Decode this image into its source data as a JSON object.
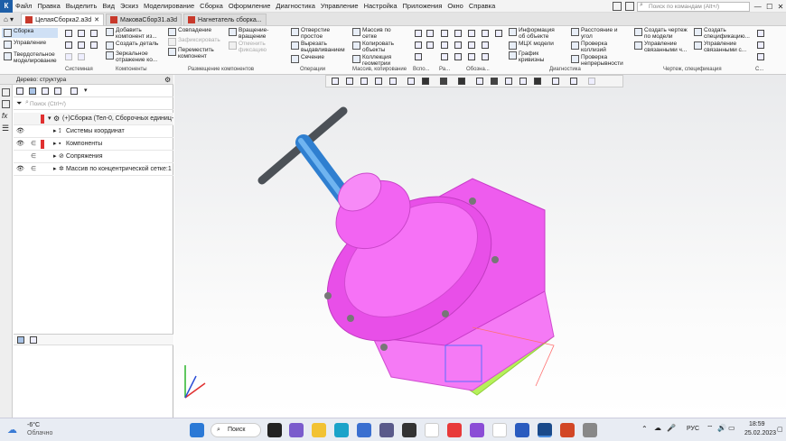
{
  "app": {
    "logo": "К"
  },
  "menu": [
    "Файл",
    "Правка",
    "Выделить",
    "Вид",
    "Эскиз",
    "Моделирование",
    "Сборка",
    "Оформление",
    "Диагностика",
    "Управление",
    "Настройка",
    "Приложения",
    "Окно",
    "Справка"
  ],
  "search": {
    "placeholder": "Поиск по командам (Alt+/)"
  },
  "window_controls": [
    "—",
    "☐",
    "✕"
  ],
  "tabs": [
    {
      "label": "ЦелаяСборка2.a3d",
      "active": true
    },
    {
      "label": "МаковаСборЗ1.a3d",
      "active": false
    },
    {
      "label": "Нагнетатель сборка...",
      "active": false
    }
  ],
  "modes": [
    "Сборка",
    "Управление",
    "Твердотельное моделирование"
  ],
  "ribbon": {
    "system": [
      "",
      "",
      ""
    ],
    "components": [
      "Добавить компонент из...",
      "Создать деталь",
      "Зеркальное отражение ко..."
    ],
    "placement": [
      "Совпадение",
      "Вращение-вращение",
      "Зафиксировать",
      "Отменить фиксацию",
      "Переместить компонент"
    ],
    "operations": [
      "Отверстие простое",
      "Вырезать выдавливанием",
      "Сечение"
    ],
    "array": [
      "Массив по сетке",
      "Копировать объекты",
      "Коллекция геометрии"
    ],
    "diagnostics": [
      "Информация об объекте",
      "МЦХ модели",
      "График кривизны",
      "Расстояние и угол",
      "Проверка коллизий",
      "Проверка непрерывности"
    ],
    "spec": [
      "Создать чертеж по модели",
      "Управление связанными ч...",
      "Создать спецификацию...",
      "Управление связанными с..."
    ],
    "group_labels": [
      "Системная",
      "Компоненты",
      "Размещение компонентов",
      "Операции",
      "Массив, копирование",
      "Вспо...",
      "Ра...",
      "Обозна...",
      "Диагностика",
      "Чертеж, спецификация",
      "С..."
    ]
  },
  "tree": {
    "title": "Дерево: структура",
    "search_placeholder": "Поиск (Ctrl+/)",
    "rows": [
      {
        "label": "(+)Сборка (Тел-0, Сборочных единиц-",
        "level": 0
      },
      {
        "label": "Системы координат",
        "level": 1
      },
      {
        "label": "Компоненты",
        "level": 1
      },
      {
        "label": "Сопряжения",
        "level": 1
      },
      {
        "label": "Массив по концентрической сетке:1",
        "level": 1
      }
    ]
  },
  "taskbar": {
    "weather_temp": "-6°C",
    "weather_text": "Облачно",
    "search_label": "Поиск",
    "lang": "РУС",
    "time": "18:59",
    "date": "25.02.2023"
  },
  "colors": {
    "part_main": "#f04ff0",
    "part_light": "#ff9cff",
    "handle_blue": "#3a8fdc",
    "handle_gray": "#555b63",
    "flange_green": "#b6f05a"
  }
}
